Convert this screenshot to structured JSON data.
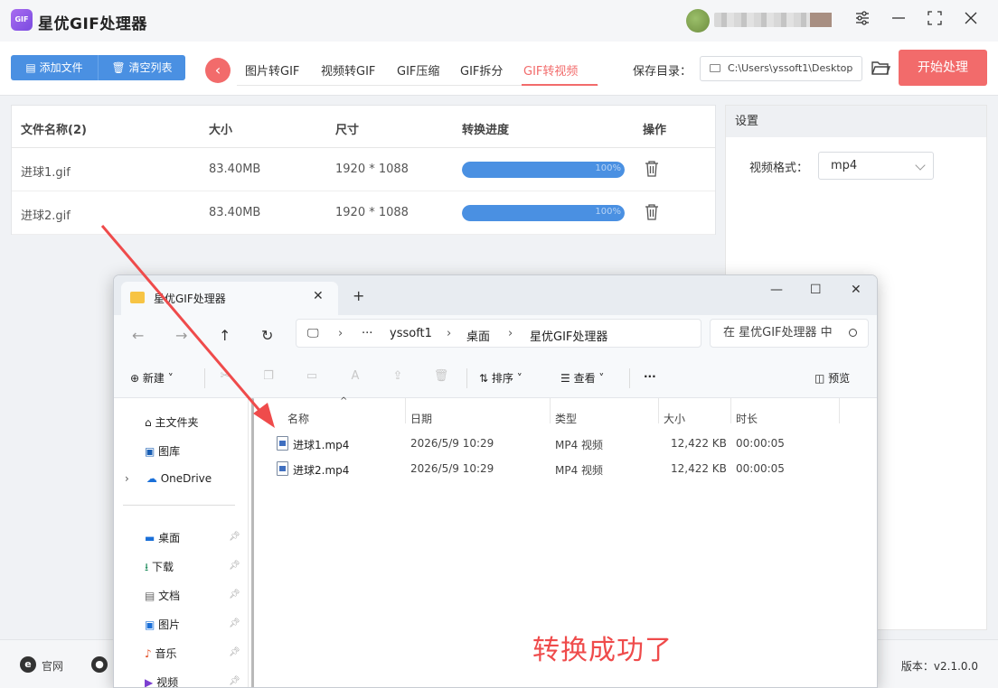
{
  "app": {
    "title": "星优GIF处理器",
    "logo_text": "GIF",
    "window_controls": [
      "settings-icon",
      "minimize-icon",
      "maximize-icon",
      "close-icon"
    ]
  },
  "toolbar": {
    "add_files": "添加文件",
    "clear_list": "清空列表",
    "tabs": [
      {
        "label": "图片转GIF",
        "active": false
      },
      {
        "label": "视频转GIF",
        "active": false
      },
      {
        "label": "GIF压缩",
        "active": false
      },
      {
        "label": "GIF拆分",
        "active": false
      },
      {
        "label": "GIF转视频",
        "active": true
      }
    ],
    "save_dir_label": "保存目录：",
    "save_dir_value": "C:\\Users\\yssoft1\\Desktop",
    "start_button": "开始处理"
  },
  "file_table": {
    "headers": [
      "文件名称(2)",
      "大小",
      "尺寸",
      "转换进度",
      "操作"
    ],
    "rows": [
      {
        "name": "进球1.gif",
        "size": "83.40MB",
        "dimensions": "1920 * 1088",
        "progress": 1.0,
        "progress_text": "100%"
      },
      {
        "name": "进球2.gif",
        "size": "83.40MB",
        "dimensions": "1920 * 1088",
        "progress": 1.0,
        "progress_text": "100%"
      }
    ]
  },
  "settings": {
    "header": "设置",
    "format_label": "视频格式：",
    "format_value": "mp4"
  },
  "footer": {
    "website": "官网",
    "version": "版本：v2.1.0.0"
  },
  "explorer": {
    "tab_title": "星优GIF处理器",
    "breadcrumb": [
      "yssoft1",
      "桌面",
      "星优GIF处理器"
    ],
    "search_placeholder": "在 星优GIF处理器 中",
    "commands": {
      "new": "新建",
      "sort": "排序",
      "view": "查看",
      "more": "···",
      "preview": "预览"
    },
    "sidebar": [
      {
        "label": "主文件夹",
        "icon": "home-icon"
      },
      {
        "label": "图库",
        "icon": "gallery-icon"
      },
      {
        "label": "OneDrive",
        "icon": "cloud-icon"
      },
      {
        "label": "桌面",
        "icon": "desktop-icon",
        "pinned": true
      },
      {
        "label": "下载",
        "icon": "download-icon",
        "pinned": true
      },
      {
        "label": "文档",
        "icon": "document-icon",
        "pinned": true
      },
      {
        "label": "图片",
        "icon": "picture-icon",
        "pinned": true
      },
      {
        "label": "音乐",
        "icon": "music-icon",
        "pinned": true
      },
      {
        "label": "视频",
        "icon": "video-icon",
        "pinned": true
      }
    ],
    "columns": [
      "名称",
      "日期",
      "类型",
      "大小",
      "时长"
    ],
    "files": [
      {
        "name": "进球1.mp4",
        "date": "2026/5/9 10:29",
        "type": "MP4 视频",
        "size": "12,422 KB",
        "duration": "00:00:05"
      },
      {
        "name": "进球2.mp4",
        "date": "2026/5/9 10:29",
        "type": "MP4 视频",
        "size": "12,422 KB",
        "duration": "00:00:05"
      }
    ]
  },
  "annotation": {
    "text": "转换成功了",
    "color": "#ef4b4b"
  },
  "colors": {
    "accent_red": "#f26b6b",
    "accent_blue": "#4a90e2"
  }
}
